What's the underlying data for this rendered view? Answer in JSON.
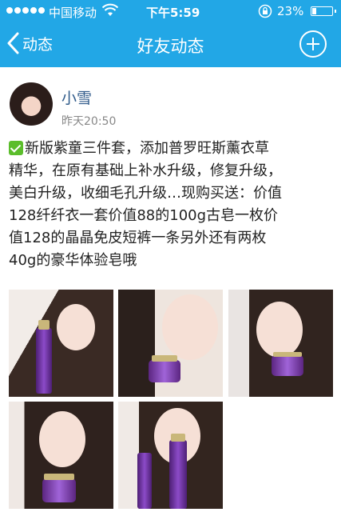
{
  "status_bar": {
    "carrier": "中国移动",
    "time": "下午5:59",
    "battery_percent": "23%",
    "battery_level": 0.23
  },
  "nav": {
    "back_label": "动态",
    "title": "好友动态"
  },
  "post": {
    "author": "小雪",
    "time": "昨天20:50",
    "text_lines": [
      "新版紫童三件套，添加普罗旺斯薰衣草",
      "精华，在原有基础上补水升级，修复升级，",
      "美白升级，收细毛孔升级…现购买送：价值",
      "128纤纤衣一套价值88的100g古皂一枚价",
      "值128的晶晶免皮短裤一条另外还有两枚",
      "40g的豪华体验皂哦"
    ],
    "photo_count": 5
  },
  "colors": {
    "accent": "#22a7e6",
    "author_name": "#2f5a8a",
    "check_green": "#5bbd2b",
    "product_purple": "#7b3fb3"
  },
  "icons": {
    "back": "chevron-left-icon",
    "add": "plus-circle-icon",
    "check": "check-mark-icon",
    "wifi": "wifi-icon",
    "lock": "rotation-lock-icon",
    "battery": "battery-icon"
  }
}
